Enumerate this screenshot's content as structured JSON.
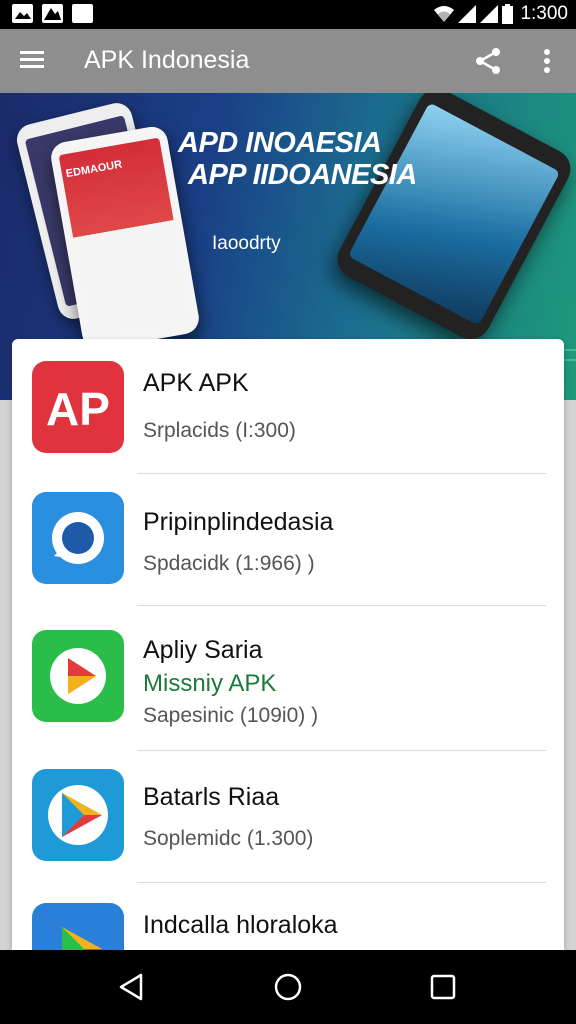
{
  "status_bar": {
    "time": "1:300",
    "left_icons": [
      "gallery-icon",
      "image-icon",
      "square-icon"
    ],
    "right_icons": [
      "wifi-icon",
      "signal-icon",
      "signal-icon",
      "battery-icon"
    ]
  },
  "app_bar": {
    "title": "APK Indonesia",
    "menu_icon": "hamburger-menu-icon",
    "share_icon": "share-icon",
    "more_icon": "more-vert-icon"
  },
  "banner": {
    "headline_line1": "APD INOAESIA",
    "headline_line2": "APP IIDOANESIA",
    "subtext": "Iaoodrty",
    "phone_screen_label": "EDMAOUR"
  },
  "apps": [
    {
      "name": "APK APK",
      "extra": "",
      "meta": "Srplacids (I:300)",
      "icon": "ap-logo-icon",
      "icon_color": "#e0333e"
    },
    {
      "name": "Pripinplindedasia",
      "extra": "",
      "meta": "Spdacidk (1:966)  )",
      "icon": "chat-ring-icon",
      "icon_color": "#2b8fe0"
    },
    {
      "name": "Apliy Saria",
      "extra": "Missniy APK",
      "meta": "Sapesinic (109i0)  )",
      "icon": "play-triangle-icon",
      "icon_color": "#2bbd4a"
    },
    {
      "name": "Batarls Riaa",
      "extra": "",
      "meta": "Soplemidc (1.300)",
      "icon": "play-store-icon",
      "icon_color": "#1e9ad6"
    },
    {
      "name": "Indcalla hloraloka",
      "extra": "",
      "meta": "",
      "icon": "play-store-icon",
      "icon_color": "#2a7fd9"
    }
  ],
  "nav_bar": {
    "back_icon": "back-triangle-icon",
    "home_icon": "home-circle-icon",
    "recents_icon": "recents-square-icon"
  }
}
